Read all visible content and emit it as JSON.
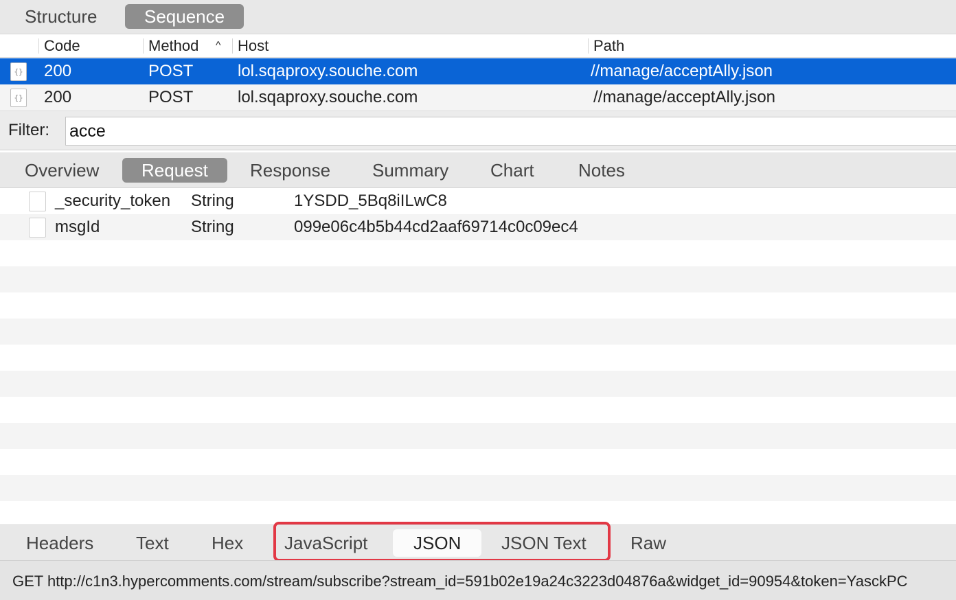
{
  "view_switch": {
    "structure_label": "Structure",
    "sequence_label": "Sequence"
  },
  "request_table": {
    "columns": {
      "code": "Code",
      "method": "Method",
      "host": "Host",
      "path": "Path"
    },
    "sort_indicator": "^",
    "rows": [
      {
        "icon": "{}",
        "code": "200",
        "method": "POST",
        "host": "lol.sqaproxy.souche.com",
        "path": "//manage/acceptAlly.json",
        "selected": true
      },
      {
        "icon": "{}",
        "code": "200",
        "method": "POST",
        "host": "lol.sqaproxy.souche.com",
        "path": "//manage/acceptAlly.json",
        "selected": false
      }
    ]
  },
  "filter": {
    "label": "Filter:",
    "value": "acce"
  },
  "detail_tabs": {
    "overview": "Overview",
    "request": "Request",
    "response": "Response",
    "summary": "Summary",
    "chart": "Chart",
    "notes": "Notes"
  },
  "params": [
    {
      "name": "_security_token",
      "type": "String",
      "value": "1YSDD_5Bq8iILwC8"
    },
    {
      "name": "msgId",
      "type": "String",
      "value": "099e06c4b5b44cd2aaf69714c0c09ec4"
    }
  ],
  "viewer_tabs": {
    "headers": "Headers",
    "text": "Text",
    "hex": "Hex",
    "javascript": "JavaScript",
    "json": "JSON",
    "json_text": "JSON Text",
    "raw": "Raw"
  },
  "status_bar": {
    "text": "GET http://c1n3.hypercomments.com/stream/subscribe?stream_id=591b02e19a24c3223d04876a&widget_id=90954&token=YasckPC"
  },
  "colors": {
    "selection": "#0a64d6",
    "highlight_border": "#e23845",
    "active_tab": "#8e8e8e"
  }
}
